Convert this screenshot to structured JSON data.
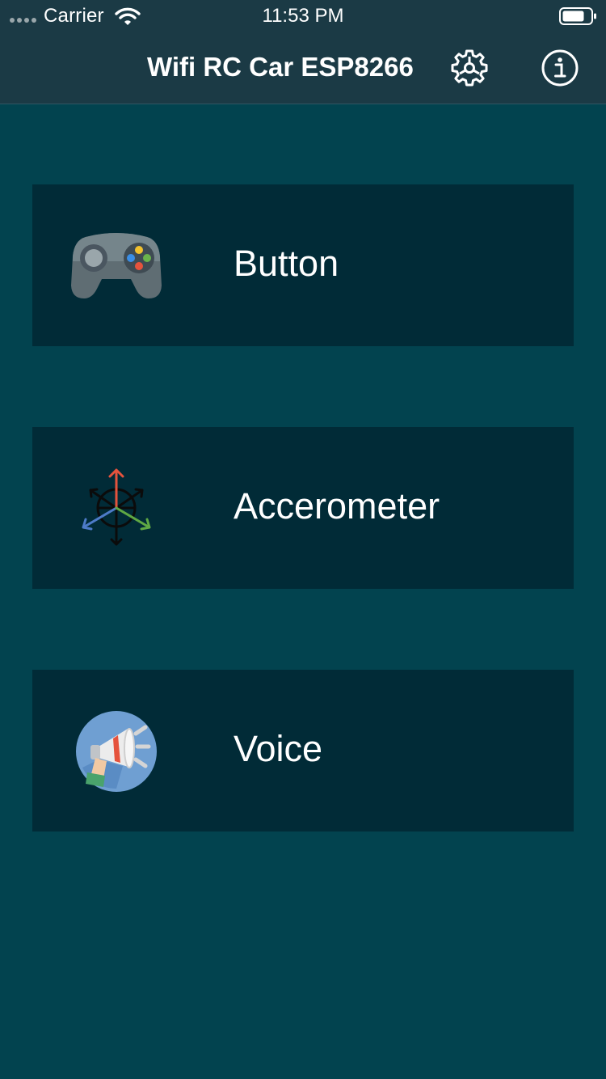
{
  "status_bar": {
    "carrier": "Carrier",
    "time": "11:53 PM",
    "icons": [
      "signal-dots-icon",
      "wifi-icon",
      "battery-icon"
    ]
  },
  "header": {
    "title": "Wifi RC Car ESP8266",
    "actions": [
      {
        "name": "settings",
        "icon": "gear-icon"
      },
      {
        "name": "info",
        "icon": "info-icon"
      }
    ]
  },
  "modes": [
    {
      "label": "Button",
      "icon": "gamepad-icon"
    },
    {
      "label": "Accerometer",
      "icon": "axis-arrows-icon"
    },
    {
      "label": "Voice",
      "icon": "megaphone-icon"
    }
  ],
  "colors": {
    "background": "#02434f",
    "header_bar": "#1b3a45",
    "card": "#012b37",
    "text": "#ffffff"
  }
}
